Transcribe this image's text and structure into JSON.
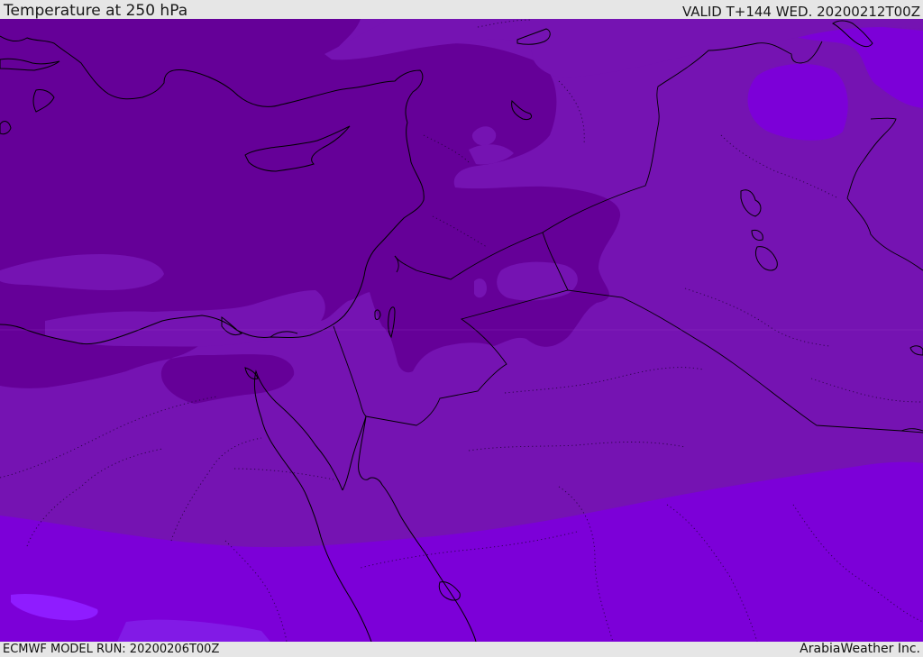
{
  "header": {
    "title": "Temperature at 250 hPa",
    "valid_time": "VALID T+144 WED. 20200212T00Z"
  },
  "footer": {
    "model_run": "ECMWF MODEL RUN: 20200206T00Z",
    "credit": "ArabiaWeather Inc."
  },
  "map": {
    "region": "Eastern Mediterranean and Middle East",
    "fill_colors": {
      "coldest": "#650098",
      "cold": "#7513b2",
      "mild": "#7c00d8",
      "warmest": "#8f1cff"
    },
    "boundary_color": "#000000"
  }
}
